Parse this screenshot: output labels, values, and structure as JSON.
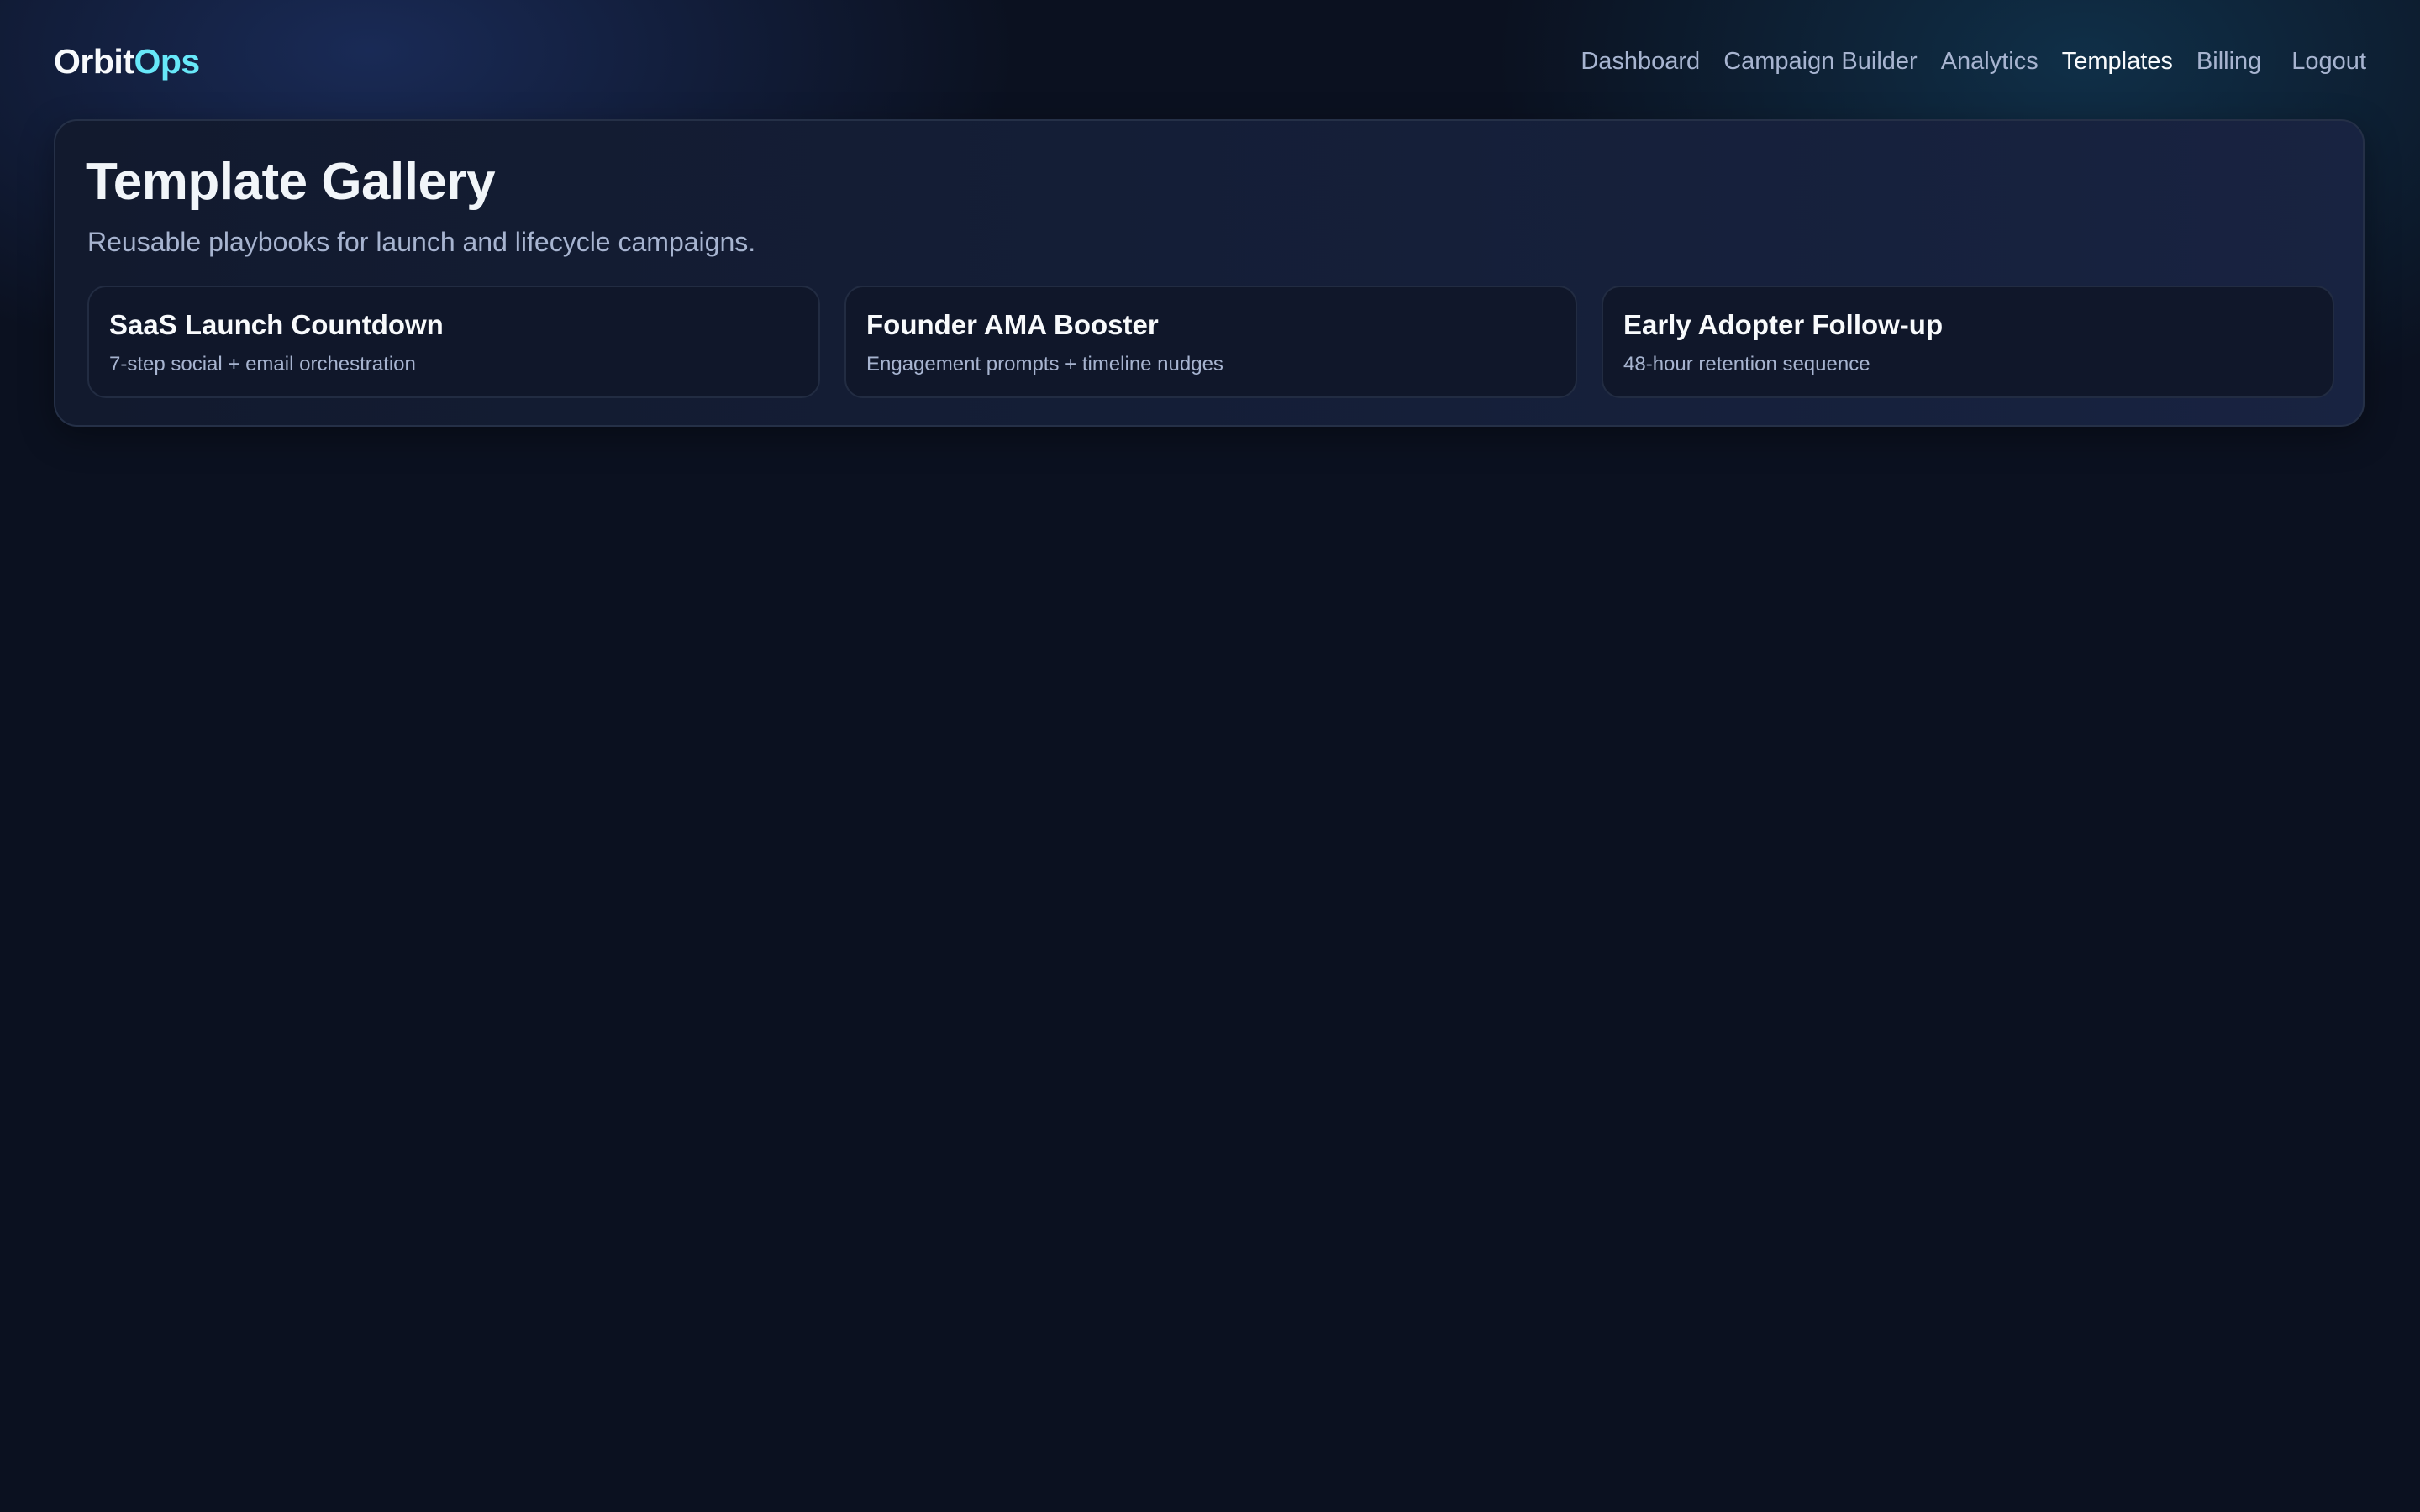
{
  "brand": {
    "part1": "Orbit",
    "part2": "Ops",
    "accent_color": "#67e8f9"
  },
  "nav": {
    "items": [
      {
        "label": "Dashboard",
        "active": false
      },
      {
        "label": "Campaign Builder",
        "active": false
      },
      {
        "label": "Analytics",
        "active": false
      },
      {
        "label": "Templates",
        "active": true
      },
      {
        "label": "Billing",
        "active": false
      }
    ],
    "logout_label": "Logout"
  },
  "gallery": {
    "title": "Template Gallery",
    "subtitle": "Reusable playbooks for launch and lifecycle campaigns.",
    "cards": [
      {
        "title": "SaaS Launch Countdown",
        "description": "7-step social + email orchestration"
      },
      {
        "title": "Founder AMA Booster",
        "description": "Engagement prompts + timeline nudges"
      },
      {
        "title": "Early Adopter Follow-up",
        "description": "48-hour retention sequence"
      }
    ]
  }
}
